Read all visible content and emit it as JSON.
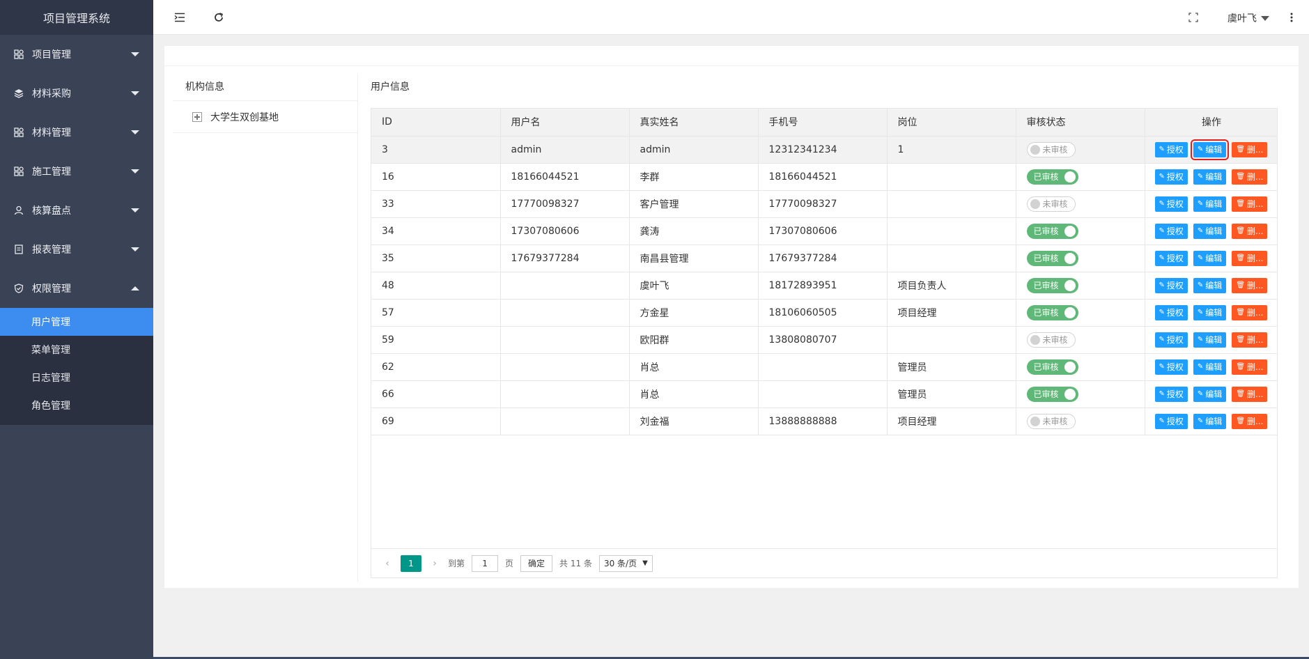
{
  "app": {
    "title": "项目管理系统"
  },
  "sidebar": {
    "groups": [
      {
        "label": "项目管理",
        "icon": "grid-icon"
      },
      {
        "label": "材料采购",
        "icon": "layers-icon"
      },
      {
        "label": "材料管理",
        "icon": "grid-icon"
      },
      {
        "label": "施工管理",
        "icon": "grid-icon"
      },
      {
        "label": "核算盘点",
        "icon": "user-icon"
      },
      {
        "label": "报表管理",
        "icon": "report-icon"
      },
      {
        "label": "权限管理",
        "icon": "shield-icon"
      }
    ],
    "subitems": [
      "用户管理",
      "菜单管理",
      "日志管理",
      "角色管理"
    ]
  },
  "topbar": {
    "user": "虞叶飞"
  },
  "org": {
    "title": "机构信息",
    "root": "大学生双创基地"
  },
  "users": {
    "title": "用户信息",
    "columns": [
      "ID",
      "用户名",
      "真实姓名",
      "手机号",
      "岗位",
      "审核状态",
      "操作"
    ],
    "status_labels": {
      "approved": "已审核",
      "pending": "未审核"
    },
    "action_labels": {
      "authorize": "授权",
      "edit": "编辑",
      "delete": "删..."
    },
    "rows": [
      {
        "id": "3",
        "username": "admin",
        "realname": "admin",
        "phone": "12312341234",
        "post": "1",
        "status": "pending"
      },
      {
        "id": "16",
        "username": "18166044521",
        "realname": "李群",
        "phone": "18166044521",
        "post": "",
        "status": "approved"
      },
      {
        "id": "33",
        "username": "17770098327",
        "realname": "客户管理",
        "phone": "17770098327",
        "post": "",
        "status": "pending"
      },
      {
        "id": "34",
        "username": "17307080606",
        "realname": "龚涛",
        "phone": "17307080606",
        "post": "",
        "status": "approved"
      },
      {
        "id": "35",
        "username": "17679377284",
        "realname": "南昌县管理",
        "phone": "17679377284",
        "post": "",
        "status": "approved"
      },
      {
        "id": "48",
        "username": "",
        "realname": "虞叶飞",
        "phone": "18172893951",
        "post": "项目负责人",
        "status": "approved"
      },
      {
        "id": "57",
        "username": "",
        "realname": "方金星",
        "phone": "18106060505",
        "post": "项目经理",
        "status": "approved"
      },
      {
        "id": "59",
        "username": "",
        "realname": "欧阳群",
        "phone": "13808080707",
        "post": "",
        "status": "pending"
      },
      {
        "id": "62",
        "username": "",
        "realname": "肖总",
        "phone": "",
        "post": "管理员",
        "status": "approved"
      },
      {
        "id": "66",
        "username": "",
        "realname": "肖总",
        "phone": "",
        "post": "管理员",
        "status": "approved"
      },
      {
        "id": "69",
        "username": "",
        "realname": "刘金福",
        "phone": "13888888888",
        "post": "项目经理",
        "status": "pending"
      }
    ]
  },
  "pager": {
    "current": "1",
    "goto_label": "到第",
    "page_input": "1",
    "page_unit": "页",
    "confirm": "确定",
    "total": "共 11 条",
    "page_size": "30 条/页"
  },
  "colors": {
    "sidebar": "#3a4255",
    "active": "#3d8cf0",
    "btn_blue": "#1e9fff",
    "btn_red": "#ff5722",
    "switch_on": "#5fb878",
    "pager_active": "#009688"
  }
}
